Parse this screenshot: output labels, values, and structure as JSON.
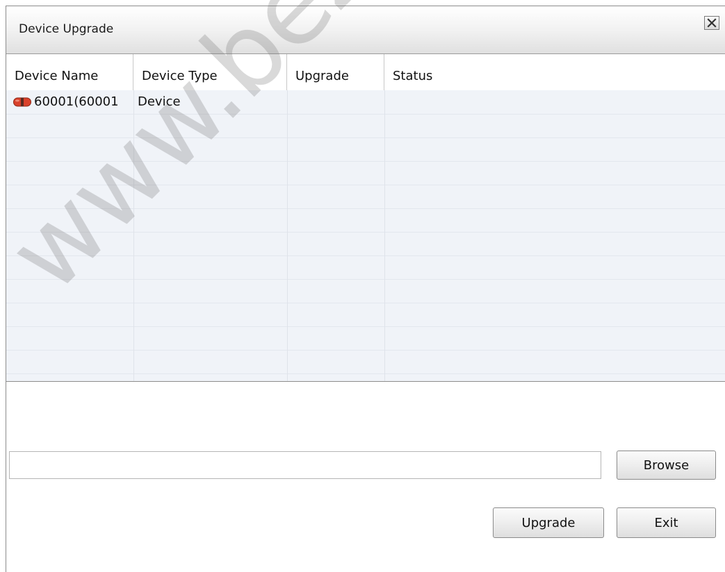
{
  "dialog": {
    "title": "Device Upgrade",
    "close_icon": "close-icon"
  },
  "table": {
    "columns": [
      "Device Name",
      "Device Type",
      "Upgrade",
      "Status"
    ],
    "rows": [
      {
        "icon": "device-icon",
        "device_name": "60001(60001",
        "device_type": "Device",
        "upgrade": "",
        "status": ""
      }
    ]
  },
  "file": {
    "path_value": "",
    "browse_label": "Browse"
  },
  "actions": {
    "upgrade_label": "Upgrade",
    "exit_label": "Exit"
  },
  "watermark": {
    "text": "www.bezpeka-she"
  },
  "colors": {
    "grid_body": "#f0f3f8",
    "device_icon": "#d9412b"
  }
}
